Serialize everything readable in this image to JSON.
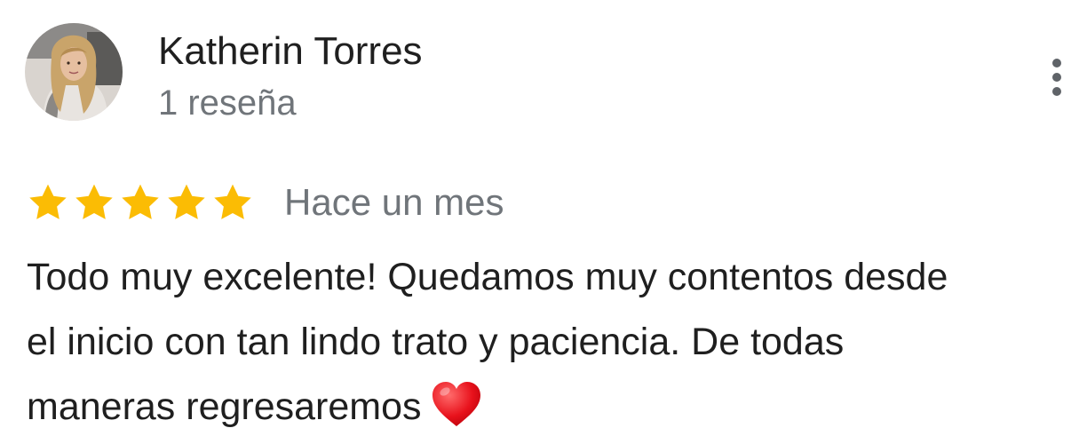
{
  "reviewer": {
    "name": "Katherin Torres",
    "review_count": "1 reseña",
    "avatar_icon": "profile-photo"
  },
  "rating": {
    "stars": 5,
    "max_stars": 5,
    "star_color": "#fbbc04"
  },
  "review": {
    "time_ago": "Hace un mes",
    "text_lines": [
      "Todo muy excelente! Quedamos muy contentos desde",
      "el inicio con tan lindo trato y paciencia. De todas",
      "maneras regresaremos"
    ],
    "emoji": "❤️",
    "emoji_icon": "red-heart-icon"
  },
  "menu": {
    "icon": "more-vert-icon"
  },
  "colors": {
    "primary_text": "#1f1f1f",
    "secondary_text": "#70757a",
    "icon": "#5f6368"
  }
}
